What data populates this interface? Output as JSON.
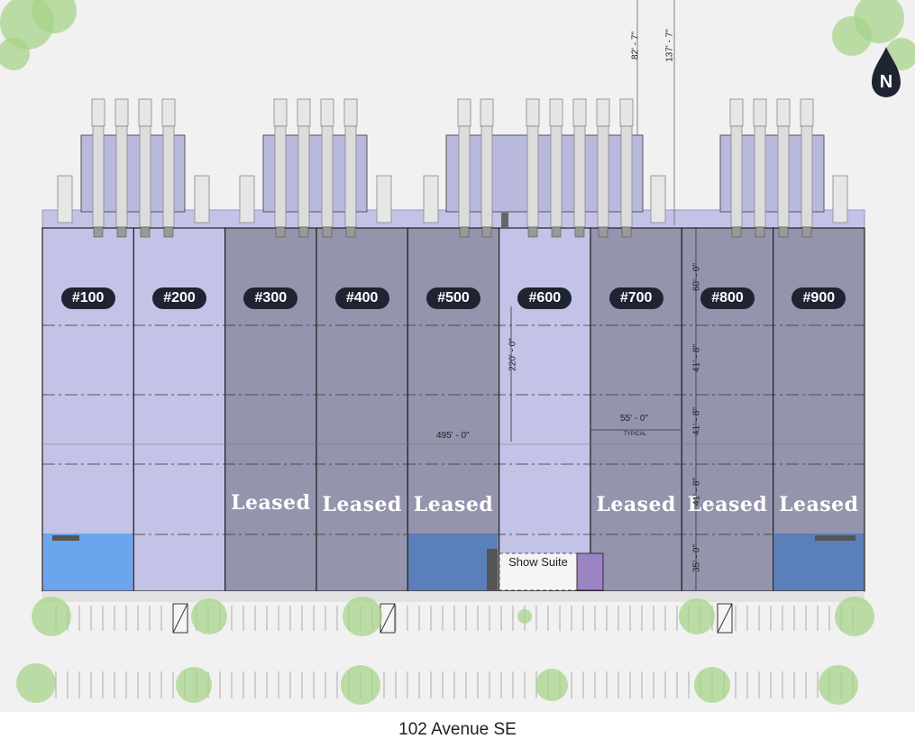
{
  "units": [
    {
      "label": "#100",
      "leased": false
    },
    {
      "label": "#200",
      "leased": false
    },
    {
      "label": "#300",
      "leased": true
    },
    {
      "label": "#400",
      "leased": true
    },
    {
      "label": "#500",
      "leased": true
    },
    {
      "label": "#600",
      "leased": false
    },
    {
      "label": "#700",
      "leased": true
    },
    {
      "label": "#800",
      "leased": true
    },
    {
      "label": "#900",
      "leased": true
    }
  ],
  "leased_text": "Leased",
  "show_suite": "Show Suite",
  "street": "102 Avenue SE",
  "north": "N",
  "dimensions": {
    "overall_length": "495' - 0\"",
    "unit_width": "55' - 0\"",
    "typical": "TYPICAL",
    "depth_600": "220' - 0\"",
    "top_82": "82' - 7\"",
    "top_137": "137' - 7\"",
    "bay_60": "60' - 0\"",
    "bay_41a": "41' - 8\"",
    "bay_41b": "41' - 8\"",
    "bay_41c": "41' - 8\"",
    "bay_35": "35' - 0\""
  },
  "colors": {
    "available": "#c3c3e8",
    "leased": "#9494ad",
    "office_highlight": "#6aa5ee",
    "office_dark": "#5b7fb8",
    "background": "#f1f1f1",
    "tree": "#a7d48a"
  }
}
